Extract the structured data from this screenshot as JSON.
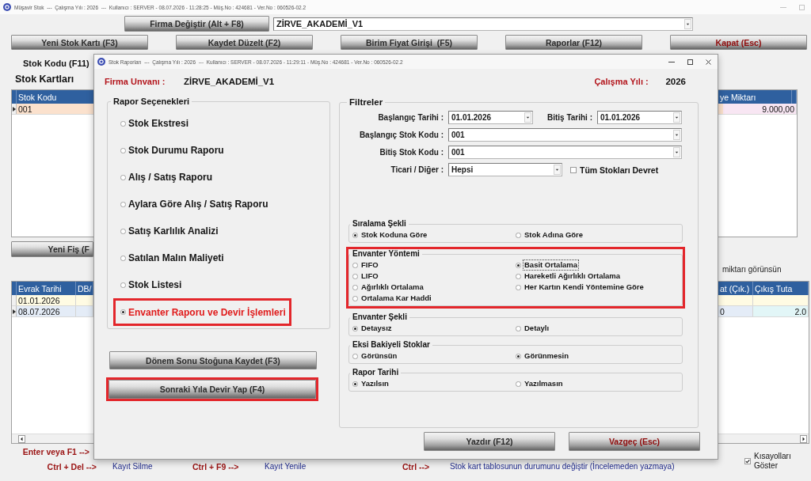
{
  "app": {
    "title": "Müşavir Stok  ---  Çalışma Yılı : 2026  ---  Kullanıcı : SERVER - 08.07.2026 - 11:28:25 - Müş.No : 424681 - Ver.No : 060526-02.2",
    "firm_button": "Firma Değiştir (Alt + F8)",
    "firm_select": {
      "value": "ZİRVE_AKADEMİ_V1"
    },
    "toolbar": [
      {
        "label": "Yeni Stok Kartı (F3)",
        "kind": "normal"
      },
      {
        "label": "Kaydet Düzelt (F2)",
        "kind": "normal"
      },
      {
        "label": "Birim Fiyat Girişi  (F5)",
        "kind": "normal"
      },
      {
        "label": "Raporlar (F12)",
        "kind": "normal"
      },
      {
        "label": "Kapat (Esc)",
        "kind": "danger"
      }
    ],
    "stock_code_label": "Stok Kodu (F11)",
    "stock_cards_title": "Stok Kartları",
    "stock_table": {
      "columns": [
        "Stok Kodu",
        "ye Miktarı"
      ],
      "rows": [
        {
          "stok_kodu": "001",
          "column_2": "9.000,00",
          "current": true
        }
      ]
    },
    "new_voucher_button": "Yeni Fiş (F",
    "note": "miktarı görünsün",
    "voucher_table": {
      "columns": [
        "Evrak Tarihi",
        "DB/",
        "at (Çık.)",
        "Çıkış Tuta"
      ],
      "rows": [
        {
          "evrak_tarihi": "01.01.2026",
          "current": false
        },
        {
          "evrak_tarihi": "08.07.2026",
          "column_3": "0",
          "column_4": "2.0",
          "current": true
        }
      ]
    },
    "shortcut_lines": [
      {
        "items": [
          {
            "key": "Enter veya F1 -->"
          }
        ]
      },
      {
        "items": [
          {
            "key": "Ctrl + Del -->",
            "action": "Kayıt Silme"
          },
          {
            "key": "Ctrl + F9 -->",
            "action": "Kayıt Yenile"
          },
          {
            "key": "Ctrl -->",
            "action": "Stok kart tablosunun durumunu değiştir (İncelemeden yazmaya)"
          }
        ]
      }
    ],
    "show_shortcuts": {
      "label": "Kısayolları Göster",
      "checked": true
    }
  },
  "dialog": {
    "title": "Stok Raporları  ---  Çalışma Yılı : 2026  ---  Kullanıcı : SERVER - 08.07.2026 - 11:29:11 - Müş.No : 424681 - Ver.No : 060526-02.2",
    "firm_label": "Firma Unvanı :",
    "firm_name": "ZİRVE_AKADEMİ_V1",
    "year_label": "Çalışma Yılı :",
    "year": "2026",
    "report_options": {
      "title": "Rapor Seçenekleri",
      "items": [
        {
          "label": "Stok Ekstresi",
          "selected": false,
          "highlighted": false
        },
        {
          "label": "Stok Durumu Raporu",
          "selected": false,
          "highlighted": false
        },
        {
          "label": "Alış / Satış Raporu",
          "selected": false,
          "highlighted": false
        },
        {
          "label": "Aylara Göre Alış / Satış Raporu",
          "selected": false,
          "highlighted": false
        },
        {
          "label": "Satış Karlılık Analizi",
          "selected": false,
          "highlighted": false
        },
        {
          "label": "Satılan Malın Maliyeti",
          "selected": false,
          "highlighted": false
        },
        {
          "label": "Stok Listesi",
          "selected": false,
          "highlighted": false
        },
        {
          "label": "Envanter Raporu ve Devir İşlemleri",
          "selected": true,
          "highlighted": true
        }
      ]
    },
    "actions": [
      {
        "label": "Dönem Sonu Stoğuna Kaydet (F3)",
        "highlighted": false
      },
      {
        "label": "Sonraki Yıla Devir Yap (F4)",
        "highlighted": true
      }
    ],
    "filters": {
      "title": "Filtreler",
      "start_date": {
        "label": "Başlangıç Tarihi :",
        "value": "01.01.2026"
      },
      "end_date": {
        "label": "Bitiş Tarihi :",
        "value": "01.01.2026"
      },
      "start_code": {
        "label": "Başlangıç Stok Kodu :",
        "value": "001"
      },
      "end_code": {
        "label": "Bitiş Stok Kodu :",
        "value": "001"
      },
      "category": {
        "label": "Ticari / Diğer :",
        "value": "Hepsi"
      },
      "transfer_all": {
        "label": "Tüm Stokları Devret",
        "checked": false
      },
      "groups": [
        {
          "title": "Sıralama Şekli",
          "highlighted": false,
          "options": [
            {
              "label": "Stok Koduna Göre",
              "selected": true,
              "focused": false
            },
            {
              "label": "Stok Adına Göre",
              "selected": false,
              "focused": false
            }
          ]
        },
        {
          "title": "Envanter Yöntemi",
          "highlighted": true,
          "options": [
            {
              "label": "FIFO",
              "selected": false,
              "focused": false
            },
            {
              "label": "Basit Ortalama",
              "selected": true,
              "focused": true
            },
            {
              "label": "LIFO",
              "selected": false,
              "focused": false
            },
            {
              "label": "Hareketli Ağırlıklı Ortalama",
              "selected": false,
              "focused": false
            },
            {
              "label": "Ağırlıklı Ortalama",
              "selected": false,
              "focused": false
            },
            {
              "label": "Her Kartın Kendi Yöntemine Göre",
              "selected": false,
              "focused": false
            },
            {
              "label": "Ortalama Kar Haddi",
              "selected": false,
              "focused": false
            }
          ]
        },
        {
          "title": "Envanter Şekli",
          "highlighted": false,
          "options": [
            {
              "label": "Detaysız",
              "selected": true,
              "focused": false
            },
            {
              "label": "Detaylı",
              "selected": false,
              "focused": false
            }
          ]
        },
        {
          "title": "Eksi Bakiyeli Stoklar",
          "highlighted": false,
          "options": [
            {
              "label": "Görünsün",
              "selected": false,
              "focused": false
            },
            {
              "label": "Görünmesin",
              "selected": true,
              "focused": false
            }
          ]
        },
        {
          "title": "Rapor Tarihi",
          "highlighted": false,
          "options": [
            {
              "label": "Yazılsın",
              "selected": true,
              "focused": false
            },
            {
              "label": "Yazılmasın",
              "selected": false,
              "focused": false
            }
          ]
        }
      ]
    },
    "buttons": [
      {
        "label": "Yazdır (F12)",
        "kind": "normal"
      },
      {
        "label": "Vazgeç (Esc)",
        "kind": "danger"
      }
    ]
  }
}
